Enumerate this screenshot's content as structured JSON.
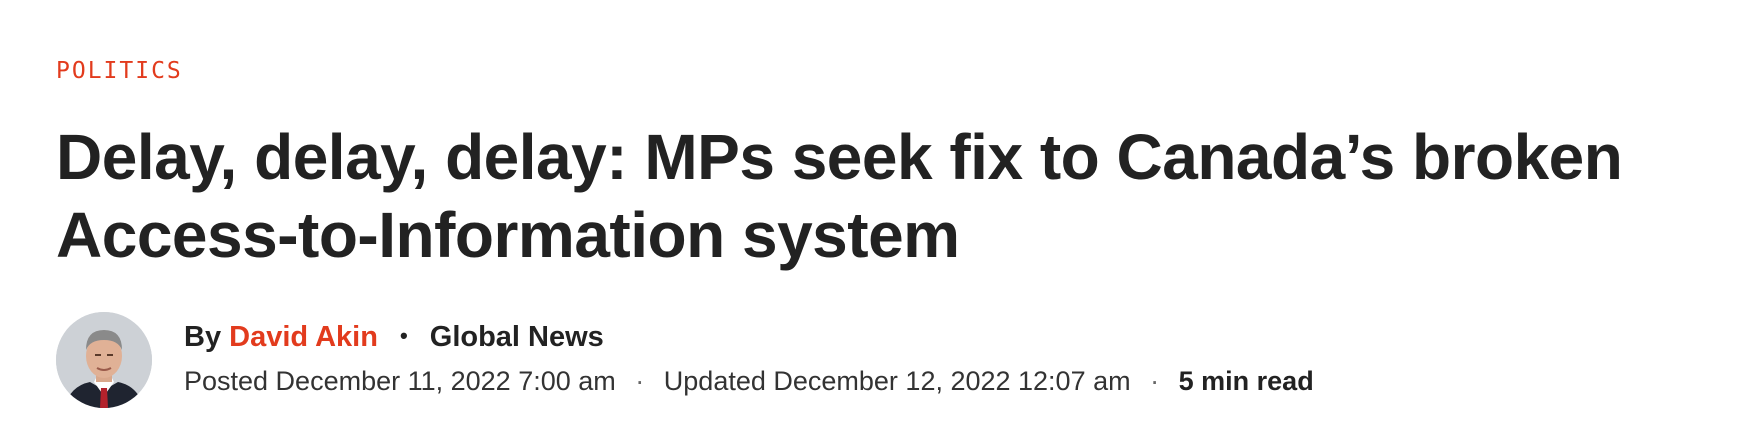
{
  "article": {
    "category": "POLITICS",
    "headline": "Delay, delay, delay: MPs seek fix to Canada’s broken Access-to-Information system",
    "byline": {
      "prefix": "By",
      "author": "David Akin",
      "separator": "•",
      "outlet": "Global News"
    },
    "meta": {
      "posted": "Posted December 11, 2022 7:00 am",
      "dot": "·",
      "updated": "Updated December 12, 2022 12:07 am",
      "read_time": "5 min read"
    }
  },
  "colors": {
    "accent": "#e23b1d",
    "text": "#222222"
  }
}
